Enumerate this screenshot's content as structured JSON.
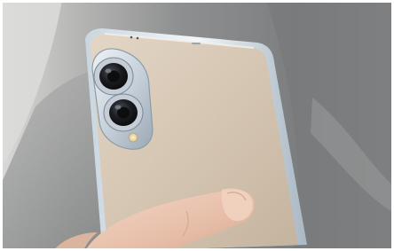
{
  "image": {
    "subject": "phone-in-hand-photo"
  }
}
